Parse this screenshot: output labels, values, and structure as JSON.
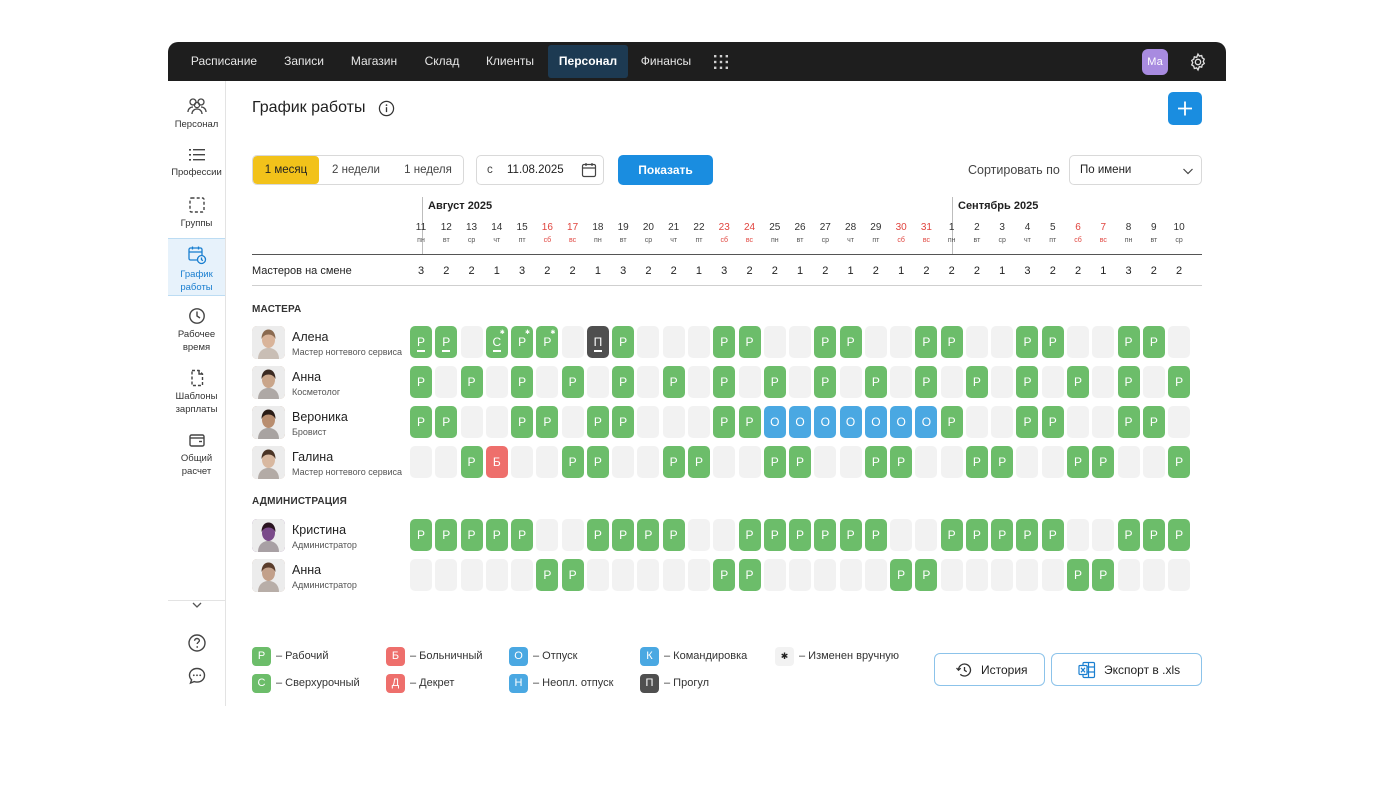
{
  "topnav": {
    "items": [
      "Расписание",
      "Записи",
      "Магазин",
      "Склад",
      "Клиенты",
      "Персонал",
      "Финансы"
    ],
    "active": "Персонал",
    "avatar_initials": "Ма"
  },
  "sidebar": {
    "items": [
      {
        "label": "Персонал",
        "icon": "people-icon"
      },
      {
        "label": "Профессии",
        "icon": "list-icon"
      },
      {
        "label": "Группы",
        "icon": "dashed-square-icon"
      },
      {
        "label": "График работы",
        "icon": "calendar-clock-icon",
        "active": true
      },
      {
        "label": "Рабочее время",
        "icon": "clock-icon"
      },
      {
        "label": "Шаблоны зарплаты",
        "icon": "document-icon"
      },
      {
        "label": "Общий расчет",
        "icon": "wallet-icon"
      }
    ]
  },
  "header": {
    "title": "График работы"
  },
  "filters": {
    "periods": [
      "1 месяц",
      "2 недели",
      "1 неделя"
    ],
    "active_period": "1 месяц",
    "date_prefix": "с",
    "date_value": "11.08.2025",
    "show_button": "Показать",
    "sort_label": "Сортировать по",
    "sort_value": "По имени"
  },
  "calendar": {
    "months": [
      {
        "label": "Август 2025"
      },
      {
        "label": "Сентябрь 2025"
      }
    ],
    "days": [
      {
        "d": "11",
        "w": "пн",
        "we": false
      },
      {
        "d": "12",
        "w": "вт",
        "we": false
      },
      {
        "d": "13",
        "w": "ср",
        "we": false
      },
      {
        "d": "14",
        "w": "чт",
        "we": false
      },
      {
        "d": "15",
        "w": "пт",
        "we": false
      },
      {
        "d": "16",
        "w": "сб",
        "we": true
      },
      {
        "d": "17",
        "w": "вс",
        "we": true
      },
      {
        "d": "18",
        "w": "пн",
        "we": false
      },
      {
        "d": "19",
        "w": "вт",
        "we": false
      },
      {
        "d": "20",
        "w": "ср",
        "we": false
      },
      {
        "d": "21",
        "w": "чт",
        "we": false
      },
      {
        "d": "22",
        "w": "пт",
        "we": false
      },
      {
        "d": "23",
        "w": "сб",
        "we": true
      },
      {
        "d": "24",
        "w": "вс",
        "we": true
      },
      {
        "d": "25",
        "w": "пн",
        "we": false
      },
      {
        "d": "26",
        "w": "вт",
        "we": false
      },
      {
        "d": "27",
        "w": "ср",
        "we": false
      },
      {
        "d": "28",
        "w": "чт",
        "we": false
      },
      {
        "d": "29",
        "w": "пт",
        "we": false
      },
      {
        "d": "30",
        "w": "сб",
        "we": true
      },
      {
        "d": "31",
        "w": "вс",
        "we": true
      },
      {
        "d": "1",
        "w": "пн",
        "we": false
      },
      {
        "d": "2",
        "w": "вт",
        "we": false
      },
      {
        "d": "3",
        "w": "ср",
        "we": false
      },
      {
        "d": "4",
        "w": "чт",
        "we": false
      },
      {
        "d": "5",
        "w": "пт",
        "we": false
      },
      {
        "d": "6",
        "w": "сб",
        "we": true
      },
      {
        "d": "7",
        "w": "вс",
        "we": true
      },
      {
        "d": "8",
        "w": "пн",
        "we": false
      },
      {
        "d": "9",
        "w": "вт",
        "we": false
      },
      {
        "d": "10",
        "w": "ср",
        "we": false
      }
    ],
    "shift_label": "Мастеров на смене",
    "shift_counts": [
      "3",
      "2",
      "2",
      "1",
      "3",
      "2",
      "2",
      "1",
      "3",
      "2",
      "2",
      "1",
      "3",
      "2",
      "2",
      "1",
      "2",
      "1",
      "2",
      "1",
      "2",
      "2",
      "2",
      "1",
      "3",
      "2",
      "2",
      "1",
      "3",
      "2",
      "2"
    ]
  },
  "sections": [
    {
      "title": "МАСТЕРА",
      "employees": [
        {
          "name": "Алена",
          "role": "Мастер ногтевого сервиса",
          "cells": [
            "Р_",
            "Р_",
            "",
            "С_*",
            "Р*",
            "Р*",
            "",
            "П_",
            "Р",
            "",
            "",
            "",
            "Р",
            "Р",
            "",
            "",
            "Р",
            "Р",
            "",
            "",
            "Р",
            "Р",
            "",
            "",
            "Р",
            "Р",
            "",
            "",
            "Р",
            "Р",
            ""
          ]
        },
        {
          "name": "Анна",
          "role": "Косметолог",
          "cells": [
            "Р",
            "",
            "Р",
            "",
            "Р",
            "",
            "Р",
            "",
            "Р",
            "",
            "Р",
            "",
            "Р",
            "",
            "Р",
            "",
            "Р",
            "",
            "Р",
            "",
            "Р",
            "",
            "Р",
            "",
            "Р",
            "",
            "Р",
            "",
            "Р",
            "",
            "Р"
          ]
        },
        {
          "name": "Вероника",
          "role": "Бровист",
          "cells": [
            "Р",
            "Р",
            "",
            "",
            "Р",
            "Р",
            "",
            "Р",
            "Р",
            "",
            "",
            "",
            "Р",
            "Р",
            "О",
            "О",
            "О",
            "О",
            "О",
            "О",
            "О",
            "Р",
            "",
            "",
            "Р",
            "Р",
            "",
            "",
            "Р",
            "Р",
            ""
          ]
        },
        {
          "name": "Галина",
          "role": "Мастер ногтевого сервиса",
          "cells": [
            "",
            "",
            "Р",
            "Б",
            "",
            "",
            "Р",
            "Р",
            "",
            "",
            "Р",
            "Р",
            "",
            "",
            "Р",
            "Р",
            "",
            "",
            "Р",
            "Р",
            "",
            "",
            "Р",
            "Р",
            "",
            "",
            "Р",
            "Р",
            "",
            "",
            "Р"
          ]
        }
      ]
    },
    {
      "title": "АДМИНИСТРАЦИЯ",
      "employees": [
        {
          "name": "Кристина",
          "role": "Администратор",
          "cells": [
            "Р",
            "Р",
            "Р",
            "Р",
            "Р",
            "",
            "",
            "Р",
            "Р",
            "Р",
            "Р",
            "",
            "",
            "Р",
            "Р",
            "Р",
            "Р",
            "Р",
            "Р",
            "",
            "",
            "Р",
            "Р",
            "Р",
            "Р",
            "Р",
            "",
            "",
            "Р",
            "Р",
            "Р"
          ]
        },
        {
          "name": "Анна",
          "role": "Администратор",
          "cells": [
            "",
            "",
            "",
            "",
            "",
            "Р",
            "Р",
            "",
            "",
            "",
            "",
            "",
            "Р",
            "Р",
            "",
            "",
            "",
            "",
            "",
            "Р",
            "Р",
            "",
            "",
            "",
            "",
            "",
            "Р",
            "Р",
            "",
            "",
            ""
          ]
        }
      ]
    }
  ],
  "legend": [
    {
      "letter": "Р",
      "text": "– Рабочий",
      "color": "#6cbd6a"
    },
    {
      "letter": "С",
      "text": "– Сверхурочный",
      "color": "#6cbd6a"
    },
    {
      "letter": "Б",
      "text": "– Больничный",
      "color": "#ee6f6c"
    },
    {
      "letter": "Д",
      "text": "– Декрет",
      "color": "#ee6f6c"
    },
    {
      "letter": "О",
      "text": "– Отпуск",
      "color": "#4aa8e2"
    },
    {
      "letter": "Н",
      "text": "– Неопл. отпуск",
      "color": "#4aa8e2"
    },
    {
      "letter": "К",
      "text": "– Командировка",
      "color": "#4aa8e2"
    },
    {
      "letter": "П",
      "text": "– Прогул",
      "color": "#4f4f4f"
    },
    {
      "letter": "✱",
      "text": "– Изменен вручную",
      "color": "#f2f2f2"
    }
  ],
  "actions": {
    "history": "История",
    "export": "Экспорт в .xls"
  },
  "colors": {
    "accent": "#1a8de0",
    "active_period": "#f2c21a",
    "working": "#6cbd6a",
    "vacation": "#4aa8e2",
    "sick": "#ee6f6c",
    "absence": "#4f4f4f",
    "weekend_text": "#e0443e"
  }
}
